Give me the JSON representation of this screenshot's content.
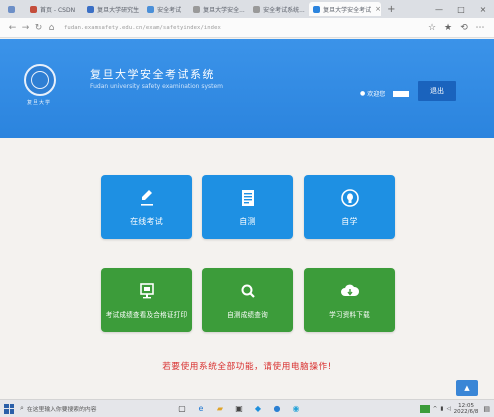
{
  "browser": {
    "tabs": [
      {
        "label": "",
        "color": "#6d8fc7"
      },
      {
        "label": "首页 - CSDN",
        "color": "#c44d3b"
      },
      {
        "label": "复旦大学研究生...",
        "color": "#3a6fc5"
      },
      {
        "label": "安全考试",
        "color": "#4a8fd8"
      },
      {
        "label": "复旦大学安全...",
        "color": "#999999"
      },
      {
        "label": "安全考试系统...",
        "color": "#999999"
      }
    ],
    "active_tab": {
      "label": "复旦大学安全考试",
      "close": "×"
    },
    "new_tab": "+",
    "window_controls": [
      "—",
      "□",
      "×"
    ],
    "nav": {
      "back": "←",
      "forward": "→",
      "reload": "↻",
      "home": "⌂"
    },
    "url": "fudan.examsafety.edu.cn/exam/safetyindex/index",
    "toolbar_icons": [
      "☆",
      "★",
      "⟲",
      "⋯"
    ]
  },
  "header": {
    "logo_caption": "复旦大学",
    "title": "复旦大学安全考试系统",
    "subtitle": "Fudan university safety examination system",
    "welcome": "欢迎您",
    "logout": "退出"
  },
  "tiles": [
    {
      "label": "在线考试",
      "icon": "pencil-icon"
    },
    {
      "label": "自测",
      "icon": "document-icon"
    },
    {
      "label": "自学",
      "icon": "lightbulb-icon"
    },
    {
      "label": "考试成绩查看及合格证打印",
      "icon": "monitor-icon"
    },
    {
      "label": "自测成绩查询",
      "icon": "magnifier-icon"
    },
    {
      "label": "学习资料下载",
      "icon": "cloud-download-icon"
    }
  ],
  "notice": "若要使用系统全部功能，请使用电脑操作!",
  "taskbar": {
    "search_text": "在这里输入你要搜索的内容",
    "time": "12:05",
    "date": "2022/6/8"
  },
  "colors": {
    "header_blue": "#2b84de",
    "tile_blue": "#1e90e3",
    "tile_green": "#3c9c3a",
    "notice_red": "#d9302f"
  }
}
